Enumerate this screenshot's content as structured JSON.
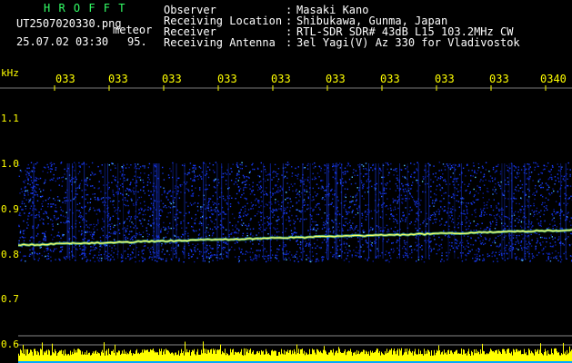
{
  "header": {
    "app_name": "H R O F F T",
    "filename": "UT2507020330.png",
    "mode": "meteor",
    "datetime": "25.07.02 03:30",
    "count": "95.",
    "fields": [
      {
        "label": "Observer",
        "sep": ":",
        "value": "Masaki Kano"
      },
      {
        "label": "Receiving Location",
        "sep": ":",
        "value": "Shibukawa, Gunma, Japan"
      },
      {
        "label": "Receiver",
        "sep": ":",
        "value": "RTL-SDR SDR# 43dB L15 103.2MHz CW"
      },
      {
        "label": "Receiving Antenna",
        "sep": ":",
        "value": "3el Yagi(V) Az 330 for Vladivostok"
      }
    ]
  },
  "time_axis": {
    "labels": [
      "033",
      "033",
      "033",
      "033",
      "033",
      "033",
      "033",
      "033",
      "033",
      "0340"
    ]
  },
  "freq_axis": {
    "unit": "kHz",
    "labels": [
      "1.1",
      "1.0",
      "0.9",
      "0.8",
      "0.7",
      "0.6"
    ]
  },
  "colors": {
    "trace": "#ffff66",
    "noise": "#1a3cff",
    "bottom_bar": "#ffff00",
    "bottom_band": "#00aaff"
  }
}
